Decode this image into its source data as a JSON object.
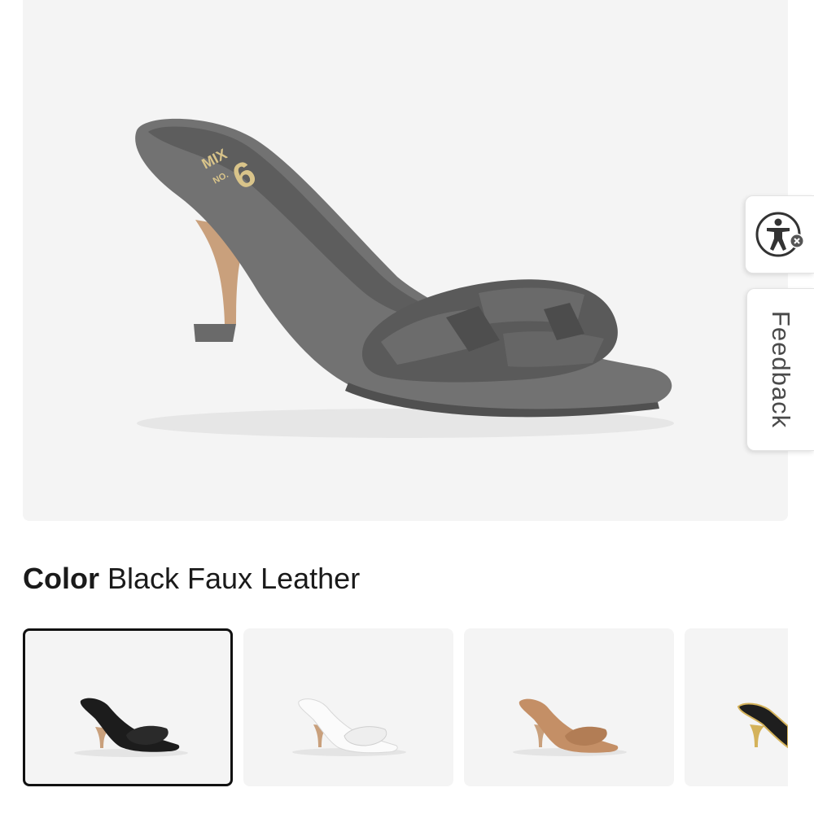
{
  "product": {
    "main_image_alt": "Black braided faux leather mule sandal",
    "brand_mark_line1": "MIX",
    "brand_mark_line2": "NO.",
    "brand_mark_num": "6"
  },
  "color_selector": {
    "label": "Color",
    "selected_value": "Black Faux Leather",
    "swatches": [
      {
        "name": "Black Faux Leather",
        "selected": true,
        "color": "#1c1c1c"
      },
      {
        "name": "White",
        "selected": false,
        "color": "#f7f7f7"
      },
      {
        "name": "Tan",
        "selected": false,
        "color": "#c48f66"
      },
      {
        "name": "Black Gold",
        "selected": false,
        "color": "#1e1e1e"
      }
    ]
  },
  "widgets": {
    "accessibility_icon": "accessibility-icon",
    "feedback_label": "Feedback"
  },
  "colors": {
    "image_bg": "#f4f4f4",
    "shoe_main": "#6e6e6e",
    "heel": "#c9a07c",
    "text": "#1a1a1a"
  }
}
